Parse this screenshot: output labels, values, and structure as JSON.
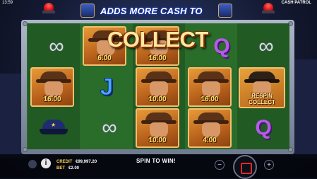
{
  "topbar": {
    "clock": "13:59",
    "title": "CASH PATROL"
  },
  "banner": {
    "text": "ADDS MORE CASH TO"
  },
  "feature": {
    "collect_title": "COLLECT",
    "respin_line1": "RESPIN",
    "respin_line2": "COLLECT"
  },
  "reels": {
    "cop_values": [
      "16.00",
      "6.00",
      "16.00",
      "10.00",
      "16.00",
      "10.00",
      "4.00"
    ],
    "symbols": [
      "handcuffs",
      "letter-j",
      "letter-q",
      "police-hat"
    ],
    "letter_j": "J",
    "letter_q": "Q"
  },
  "bottom": {
    "credit_label": "CREDIT",
    "credit_value": "€99,997.20",
    "bet_label": "BET",
    "bet_value": "€2.00",
    "spin_prompt": "SPIN TO WIN!",
    "minus": "−",
    "plus": "+",
    "info": "i"
  },
  "colors": {
    "reel_green": "#2b6e2c",
    "card_orange": "#d9852c",
    "value_yellow": "#ffe36a",
    "accent_blue": "#2c58ff"
  }
}
